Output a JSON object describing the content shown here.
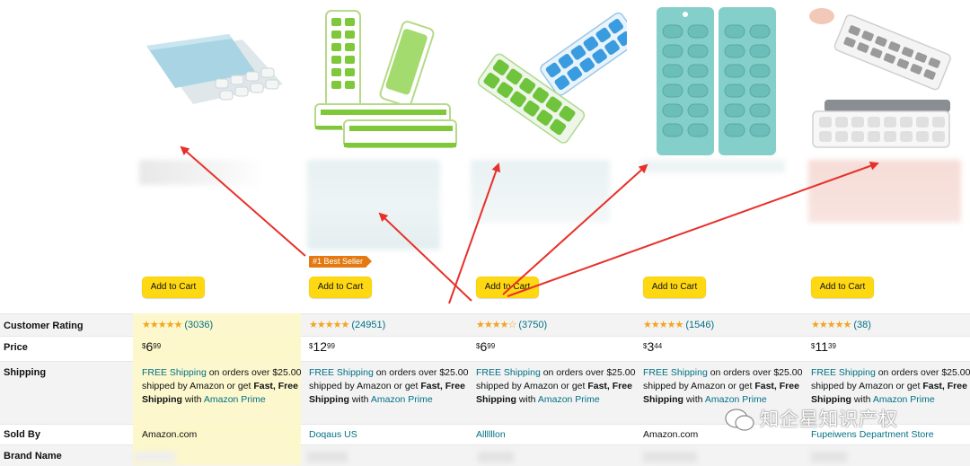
{
  "products": [
    {
      "image_icon": "ice-tray-blue-lid-icon",
      "add_to_cart": "Add to Cart",
      "stars": "★★★★★",
      "rating_count": "(3036)",
      "price_dollars": "6",
      "price_cents": "99",
      "shipping_free": "FREE Shipping",
      "shipping_rest": " on orders over $25.00 shipped by Amazon or get ",
      "shipping_fast": "Fast, Free Shipping",
      "shipping_with": " with ",
      "shipping_prime": "Amazon Prime",
      "sold_by": "Amazon.com",
      "sold_by_is_link": false
    },
    {
      "image_icon": "ice-tray-green-stack-icon",
      "best_seller": "#1 Best Seller",
      "add_to_cart": "Add to Cart",
      "stars": "★★★★★",
      "rating_count": "(24951)",
      "price_dollars": "12",
      "price_cents": "99",
      "shipping_free": "FREE Shipping",
      "shipping_rest": " on orders over $25.00 shipped by Amazon or get ",
      "shipping_fast": "Fast, Free Shipping",
      "shipping_with": " with ",
      "shipping_prime": "Amazon Prime",
      "sold_by": "Doqaus US",
      "sold_by_is_link": true
    },
    {
      "image_icon": "ice-tray-green-blue-icon",
      "add_to_cart": "Add to Cart",
      "stars": "★★★★☆",
      "rating_count": "(3750)",
      "price_dollars": "6",
      "price_cents": "99",
      "shipping_free": "FREE Shipping",
      "shipping_rest": " on orders over $25.00 shipped by Amazon or get ",
      "shipping_fast": "Fast, Free Shipping",
      "shipping_with": " with ",
      "shipping_prime": "Amazon Prime",
      "sold_by": "Allllllon",
      "sold_by_is_link": true
    },
    {
      "image_icon": "ice-tray-teal-pair-icon",
      "add_to_cart": "Add to Cart",
      "stars": "★★★★★",
      "rating_count": "(1546)",
      "price_dollars": "3",
      "price_cents": "44",
      "shipping_free": "FREE Shipping",
      "shipping_rest": " on orders over $25.00 shipped by Amazon or get ",
      "shipping_fast": "Fast, Free Shipping",
      "shipping_with": " with ",
      "shipping_prime": "Amazon Prime",
      "sold_by": "Amazon.com",
      "sold_by_is_link": false
    },
    {
      "image_icon": "ice-tray-white-lid-icon",
      "add_to_cart": "Add to Cart",
      "stars": "★★★★★",
      "rating_count": "(38)",
      "price_dollars": "11",
      "price_cents": "39",
      "shipping_free": "FREE Shipping",
      "shipping_rest": " on orders over $25.00 shipped by Amazon or get ",
      "shipping_fast": "Fast, Free Shipping",
      "shipping_with": " with ",
      "shipping_prime": "Amazon Prime",
      "sold_by": "Fupeiwens Department Store",
      "sold_by_is_link": true
    }
  ],
  "row_labels": {
    "rating": "Customer Rating",
    "price": "Price",
    "shipping": "Shipping",
    "sold_by": "Sold By",
    "brand": "Brand Name"
  },
  "watermark": "知企星知识产权",
  "colors": {
    "button": "#ffd814",
    "link": "#007185",
    "star": "#f4a41d",
    "arrow": "#e8302a",
    "highlight_col": "#fefbdc",
    "best_seller": "#e47911"
  }
}
